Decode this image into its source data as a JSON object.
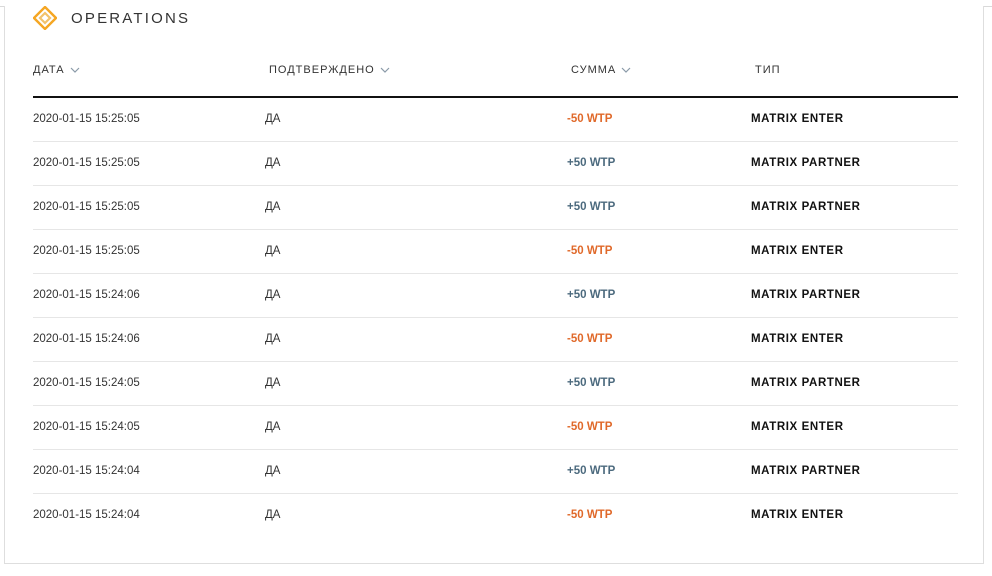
{
  "header": {
    "title": "OPERATIONS",
    "logo_icon": "diamond-logo-icon",
    "logo_colors": [
      "#f5a623",
      "#f2c26b"
    ]
  },
  "table": {
    "columns": [
      {
        "label": "ДАТА",
        "sortable": true
      },
      {
        "label": "ПОДТВЕРЖДЕНО",
        "sortable": true
      },
      {
        "label": "СУММА",
        "sortable": true
      },
      {
        "label": "ТИП",
        "sortable": false
      }
    ],
    "rows": [
      {
        "date": "2020-01-15 15:25:05",
        "confirmed": "ДА",
        "amount": "-50 WTP",
        "sign": "neg",
        "type": "MATRIX ENTER"
      },
      {
        "date": "2020-01-15 15:25:05",
        "confirmed": "ДА",
        "amount": "+50 WTP",
        "sign": "pos",
        "type": "MATRIX PARTNER"
      },
      {
        "date": "2020-01-15 15:25:05",
        "confirmed": "ДА",
        "amount": "+50 WTP",
        "sign": "pos",
        "type": "MATRIX PARTNER"
      },
      {
        "date": "2020-01-15 15:25:05",
        "confirmed": "ДА",
        "amount": "-50 WTP",
        "sign": "neg",
        "type": "MATRIX ENTER"
      },
      {
        "date": "2020-01-15 15:24:06",
        "confirmed": "ДА",
        "amount": "+50 WTP",
        "sign": "pos",
        "type": "MATRIX PARTNER"
      },
      {
        "date": "2020-01-15 15:24:06",
        "confirmed": "ДА",
        "amount": "-50 WTP",
        "sign": "neg",
        "type": "MATRIX ENTER"
      },
      {
        "date": "2020-01-15 15:24:05",
        "confirmed": "ДА",
        "amount": "+50 WTP",
        "sign": "pos",
        "type": "MATRIX PARTNER"
      },
      {
        "date": "2020-01-15 15:24:05",
        "confirmed": "ДА",
        "amount": "-50 WTP",
        "sign": "neg",
        "type": "MATRIX ENTER"
      },
      {
        "date": "2020-01-15 15:24:04",
        "confirmed": "ДА",
        "amount": "+50 WTP",
        "sign": "pos",
        "type": "MATRIX PARTNER"
      },
      {
        "date": "2020-01-15 15:24:04",
        "confirmed": "ДА",
        "amount": "-50 WTP",
        "sign": "neg",
        "type": "MATRIX ENTER"
      }
    ]
  },
  "colors": {
    "negative": "#e0692a",
    "positive": "#4c6a7e",
    "header_rule": "#111111"
  }
}
